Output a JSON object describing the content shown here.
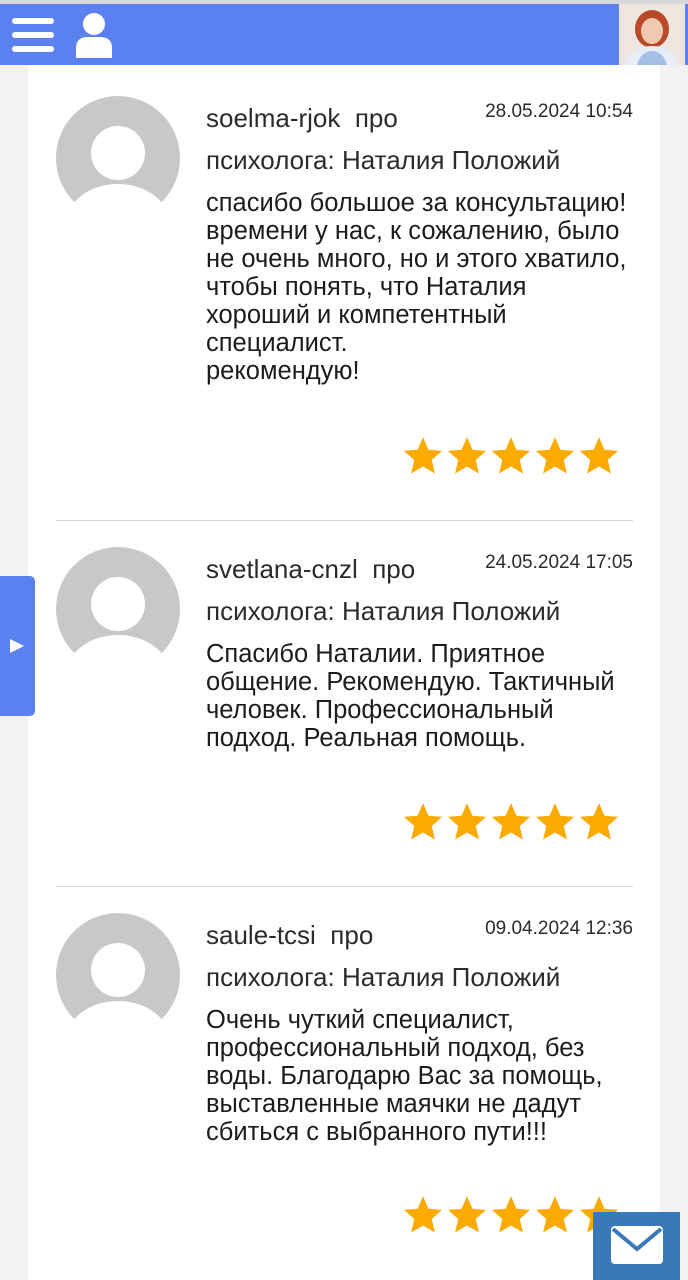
{
  "header": {
    "menu_icon": "hamburger-menu-icon",
    "user_icon": "user-icon",
    "photo": "psychologist-photo"
  },
  "reviews": [
    {
      "author": "soelma-rjok",
      "pro": "про",
      "date": "28.05.2024 10:54",
      "about": "психолога: Наталия Положий",
      "text": "спасибо большое за консультацию!\nвремени у нас, к сожалению, было не очень много, но и этого хватило, чтобы понять, что Наталия хороший и компетентный специалист.\nрекомендую!",
      "rating": 5
    },
    {
      "author": "svetlana-cnzl",
      "pro": "про",
      "date": "24.05.2024 17:05",
      "about": "психолога: Наталия Положий",
      "text": "Спасибо Наталии. Приятное общение. Рекомендую. Тактичный человек. Профессиональный подход. Реальная помощь.",
      "rating": 5
    },
    {
      "author": "saule-tcsi",
      "pro": "про",
      "date": "09.04.2024 12:36",
      "about": "психолога: Наталия Положий",
      "text": "Очень чуткий специалист, профессиональный подход, без воды. Благодарю Вас за помощь, выставленные маячки не дадут сбиться с выбранного пути!!!",
      "rating": 5
    }
  ],
  "colors": {
    "header": "#5b81f1",
    "star": "#fbaa00",
    "avatar": "#c8c8c8",
    "mail_button": "#3b78b8"
  },
  "side_tab_icon": "play-arrow-icon",
  "mail_icon": "envelope-icon"
}
